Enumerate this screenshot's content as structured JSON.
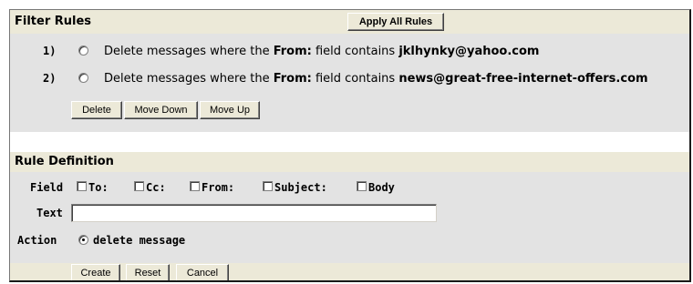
{
  "filter_rules": {
    "title": "Filter Rules",
    "apply_all_label": "Apply All Rules",
    "rules": [
      {
        "number": "1)",
        "prefix": "Delete messages where the ",
        "field": "From:",
        "middle": " field contains ",
        "value": "jklhynky@yahoo.com"
      },
      {
        "number": "2)",
        "prefix": "Delete messages where the ",
        "field": "From:",
        "middle": " field contains ",
        "value": "news@great-free-internet-offers.com"
      }
    ],
    "buttons": {
      "delete": "Delete",
      "move_down": "Move Down",
      "move_up": "Move Up"
    }
  },
  "rule_definition": {
    "title": "Rule Definition",
    "field_label": "Field",
    "fields": {
      "to": "To:",
      "cc": "Cc:",
      "from": "From:",
      "subject": "Subject:",
      "body": "Body"
    },
    "text_label": "Text",
    "text_value": "",
    "action_label": "Action",
    "action_option": "delete message",
    "buttons": {
      "create": "Create",
      "reset": "Reset",
      "cancel": "Cancel"
    }
  }
}
